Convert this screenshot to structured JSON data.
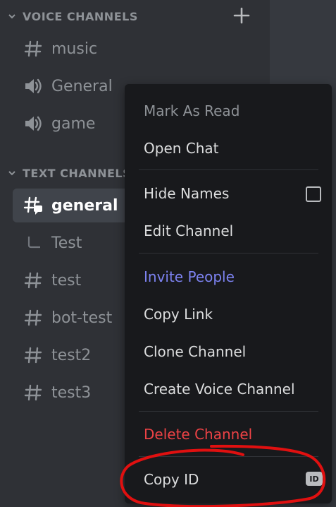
{
  "sidebar": {
    "voice_category": "VOICE CHANNELS",
    "text_category": "TEXT CHANNELS",
    "voice_channels": [
      {
        "label": "music",
        "icon": "hash-icon"
      },
      {
        "label": "General",
        "icon": "speaker-icon"
      },
      {
        "label": "game",
        "icon": "speaker-icon"
      }
    ],
    "text_channels": [
      {
        "label": "general",
        "icon": "hash-thread-icon",
        "active": true
      },
      {
        "label": "Test",
        "icon": "thread-branch-icon"
      },
      {
        "label": "test",
        "icon": "hash-icon"
      },
      {
        "label": "bot-test",
        "icon": "hash-icon"
      },
      {
        "label": "test2",
        "icon": "hash-icon"
      },
      {
        "label": "test3",
        "icon": "hash-icon"
      }
    ]
  },
  "context_menu": {
    "mark_as_read": "Mark As Read",
    "open_chat": "Open Chat",
    "hide_names": "Hide Names",
    "edit_channel": "Edit Channel",
    "invite_people": "Invite People",
    "copy_link": "Copy Link",
    "clone_channel": "Clone Channel",
    "create_voice_channel": "Create Voice Channel",
    "delete_channel": "Delete Channel",
    "copy_id": "Copy ID",
    "id_badge": "ID"
  },
  "colors": {
    "sidebar_bg": "#2f3136",
    "menu_bg": "#18191c",
    "invite_blue": "#7c82f0",
    "danger_red": "#ed4245",
    "annotation_red": "#e01010"
  }
}
